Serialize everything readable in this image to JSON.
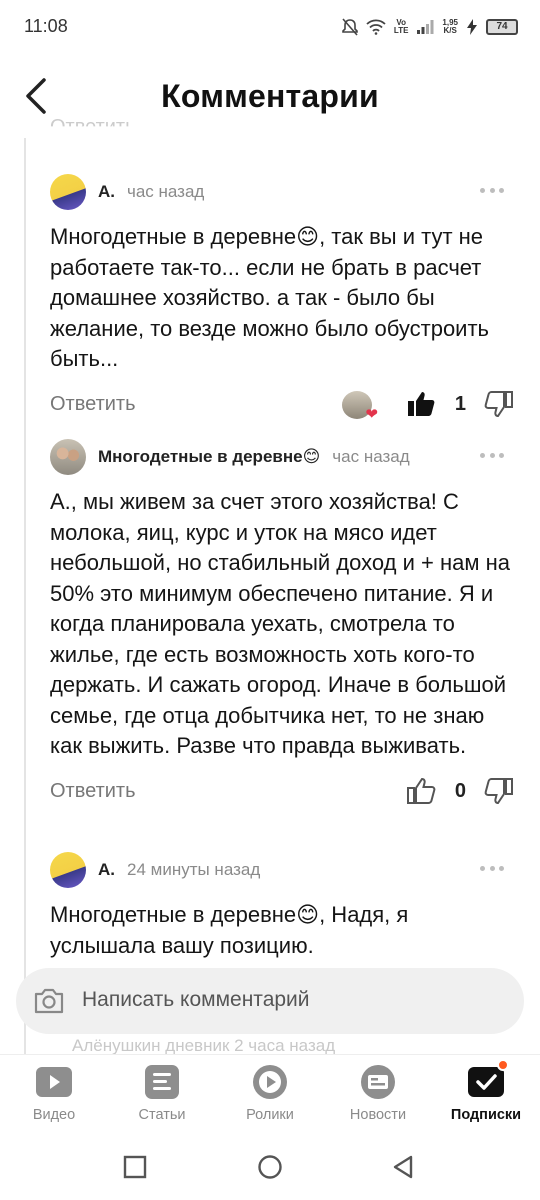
{
  "status_bar": {
    "time": "11:08",
    "network_top": "Vo",
    "network_bottom": "LTE",
    "speed_value": "1,95",
    "speed_unit": "K/S",
    "battery": "74"
  },
  "header": {
    "title": "Комментарии",
    "back_icon": "chevron-left-icon"
  },
  "faded_top_text": "Ответить",
  "comments": [
    {
      "author": "А.",
      "time": "час назад",
      "text": "Многодетные в деревне😊, так вы и тут не работаете так-то... если не брать в расчет домашнее хозяйство. а так - было бы желание, то везде можно было обустроить быть...",
      "reply_label": "Ответить",
      "likes": "1",
      "liked": true
    },
    {
      "author": "Многодетные в деревне😊",
      "time": "час назад",
      "text": "А., мы живем за счет этого хозяйства! С молока, яиц, курс и уток на мясо идет небольшой, но стабильный доход и + нам на 50% это минимум обеспечено питание. Я и когда планировала уехать, смотрела то жилье, где есть возможность хоть кого-то держать. И сажать огород. Иначе в большой семье, где отца добытчика нет, то не знаю как выжить. Разве что правда выживать.",
      "reply_label": "Ответить",
      "likes": "0",
      "liked": false
    },
    {
      "author": "А.",
      "time": "24 минуты назад",
      "text": "Многодетные в деревне😊, Надя, я услышала вашу позицию."
    }
  ],
  "composer": {
    "placeholder": "Написать комментарий",
    "icon": "camera-icon"
  },
  "ghost_row": "Алёнушкин дневник  2 часа назад",
  "tabs": [
    {
      "label": "Видео",
      "icon": "video-play-icon",
      "active": false
    },
    {
      "label": "Статьи",
      "icon": "articles-icon",
      "active": false
    },
    {
      "label": "Ролики",
      "icon": "clips-icon",
      "active": false
    },
    {
      "label": "Новости",
      "icon": "news-icon",
      "active": false
    },
    {
      "label": "Подписки",
      "icon": "subscriptions-icon",
      "active": true
    }
  ],
  "colors": {
    "accent_badge": "#ff5a1f",
    "like_active": "#111111",
    "muted_text": "#8a8a8a"
  }
}
